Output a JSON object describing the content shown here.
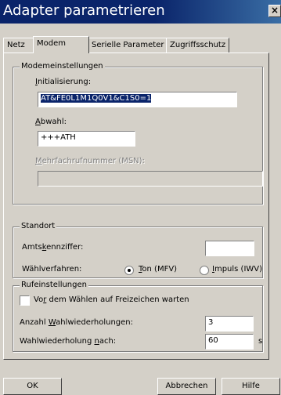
{
  "window": {
    "title": "Adapter parametrieren",
    "close_glyph": "×"
  },
  "tabs": [
    {
      "label": "Netz"
    },
    {
      "label": "Modem"
    },
    {
      "label": "Serielle Parameter"
    },
    {
      "label": "Zugriffsschutz"
    }
  ],
  "modem": {
    "legend": "Modemeinstellungen",
    "init_label": "Initialisierung:",
    "init_value": "AT&FE0L1M1Q0V1&C1S0=1",
    "dial_label": "Abwahl:",
    "dial_value": "+++ATH",
    "msn_label": "Mehrfachrufnummer (MSN):",
    "msn_value": ""
  },
  "location": {
    "legend": "Standort",
    "code_label": "Amtskennziffer:",
    "code_value": "",
    "method_label": "Wählverfahren:",
    "option_tone": "Ton (MFV)",
    "option_pulse": "Impuls (IWV)",
    "selected": "tone"
  },
  "call": {
    "legend": "Rufeinstellungen",
    "wait_label": "Vor dem Wählen auf Freizeichen warten",
    "wait_checked": false,
    "repeat_label": "Anzahl Wahlwiederholungen:",
    "repeat_value": "3",
    "after_label": "Wahlwiederholung nach:",
    "after_value": "60",
    "after_unit": "s"
  },
  "buttons": {
    "ok": "OK",
    "cancel": "Abbrechen",
    "help": "Hilfe"
  }
}
